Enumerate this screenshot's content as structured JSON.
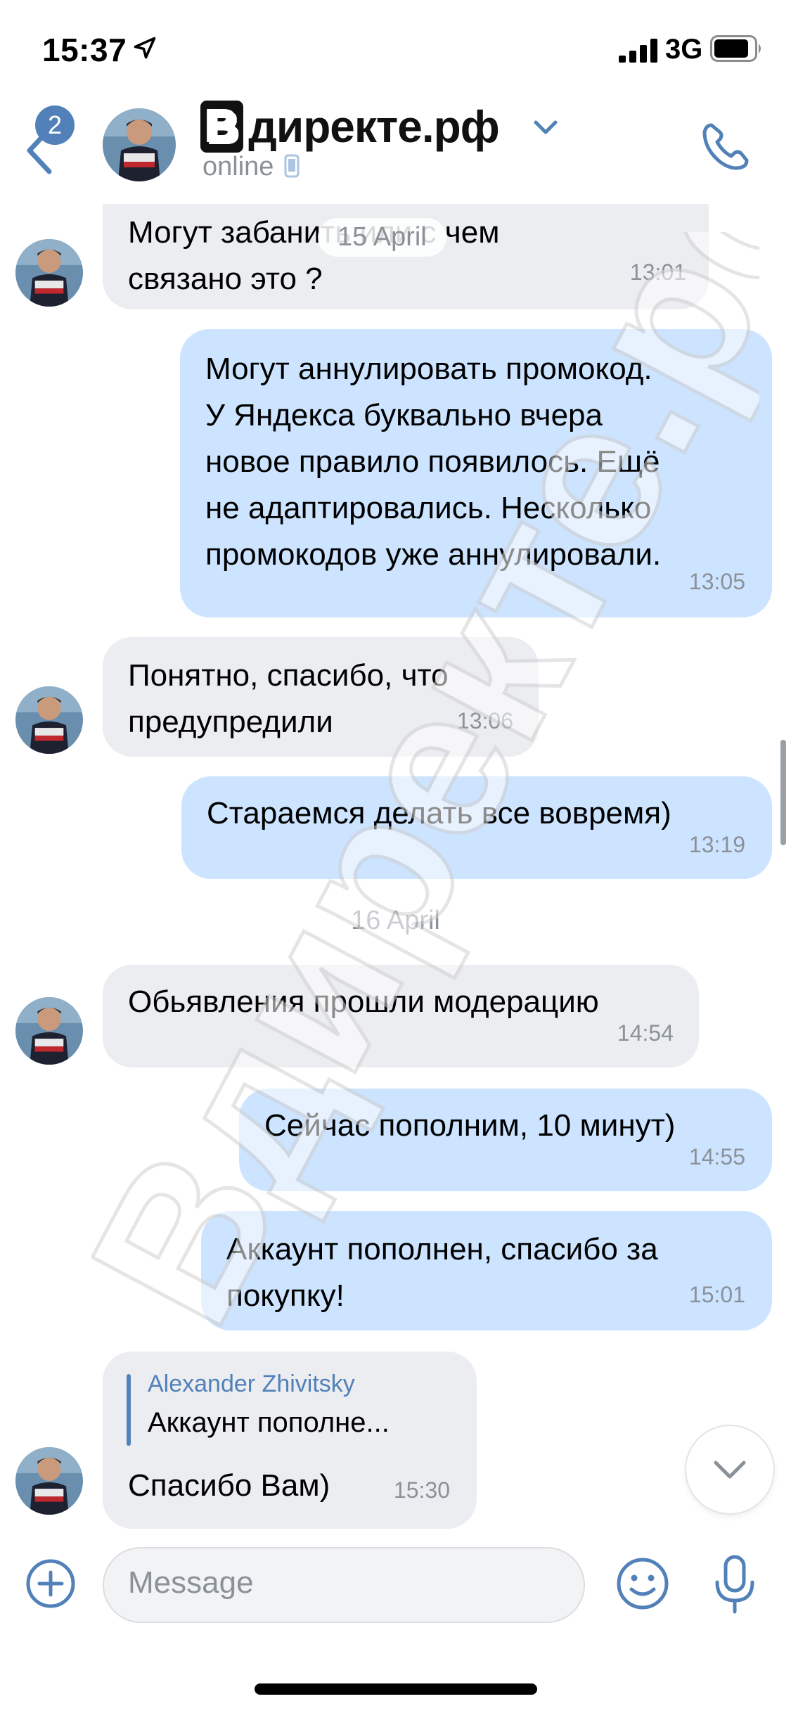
{
  "status_bar": {
    "time": "15:37",
    "network": "3G"
  },
  "header": {
    "back_badge": "2",
    "title_box": "В",
    "title_rest": "директе.рф",
    "status": "online"
  },
  "messages": [
    {
      "dir": "in",
      "lines": [
        "Могут забанить или с чем",
        "связано это ?"
      ],
      "time": "13:01"
    },
    {
      "dir": "out",
      "lines": [
        "Могут аннулировать промокод.",
        "У Яндекса буквально вчера",
        "новое правило появилось. Ещё",
        "не адаптировались. Несколько",
        "промокодов уже аннулировали."
      ],
      "time": "13:05"
    },
    {
      "dir": "in",
      "lines": [
        "Понятно, спасибо, что",
        "предупредили"
      ],
      "time": "13:06"
    },
    {
      "dir": "out",
      "lines": [
        "Стараемся делать все вовремя)"
      ],
      "time": "13:19"
    },
    {
      "dir": "in",
      "lines": [
        "Обьявления прошли модерацию"
      ],
      "time": "14:54"
    },
    {
      "dir": "out",
      "lines": [
        "Сейчас пополним, 10 минут)"
      ],
      "time": "14:55"
    },
    {
      "dir": "out",
      "lines": [
        "Аккаунт пополнен, спасибо за",
        "покупку!"
      ],
      "time": "15:01"
    },
    {
      "dir": "in",
      "reply_author": "Alexander Zhivitsky",
      "reply_text": "Аккаунт пополне...",
      "lines": [
        "Спасибо Вам)"
      ],
      "time": "15:30"
    }
  ],
  "date_separators": [
    "15 April",
    "16 April"
  ],
  "composer": {
    "placeholder": "Message"
  },
  "icons": {
    "back": "chevron-left-icon",
    "call": "phone-icon",
    "add": "plus-circle-icon",
    "emoji": "smile-icon",
    "mic": "microphone-icon",
    "scroll_down": "chevron-down-icon"
  },
  "colors": {
    "accent": "#5181b8",
    "incoming_bubble": "#ebedf0",
    "outgoing_bubble": "#cce4ff",
    "timestamp": "#8b9199"
  }
}
